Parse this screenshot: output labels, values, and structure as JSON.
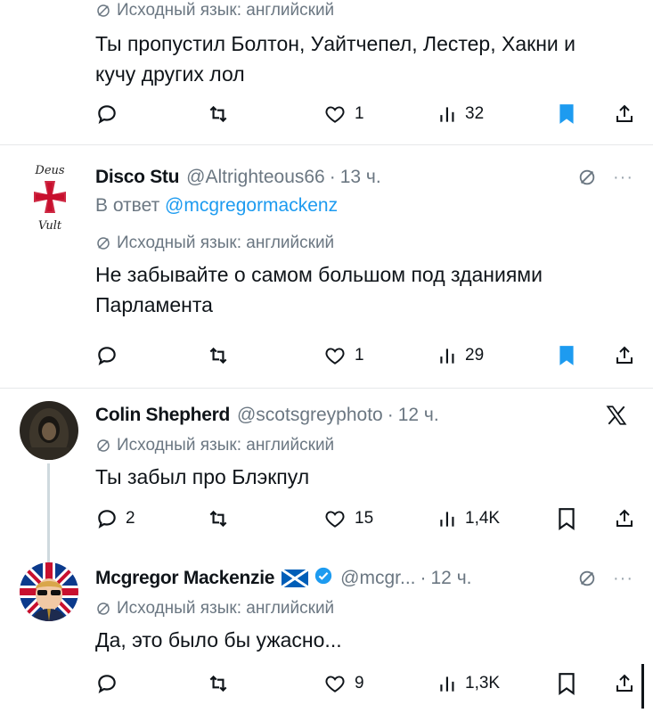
{
  "tweets": [
    {
      "translated_label": "Исходный язык: английский",
      "text": "Ты пропустил Болтон, Уайтчепел, Лестер, Хакни и кучу других лол",
      "actions": {
        "replies": "",
        "retweets": "",
        "likes": "1",
        "views": "32",
        "bookmarked": true
      }
    },
    {
      "name": "Disco Stu",
      "handle": "@Altrighteous66",
      "time": "13 ч.",
      "avatar_text_top": "Deus",
      "avatar_text_bottom": "Vult",
      "replying_prefix": "В ответ",
      "replying_to": "@mcgregormackenz",
      "translated_label": "Исходный язык: английский",
      "text": "Не забывайте о самом большом под зданиями Парламента",
      "actions": {
        "replies": "",
        "retweets": "",
        "likes": "1",
        "views": "29",
        "bookmarked": true
      }
    },
    {
      "name": "Colin Shepherd",
      "handle": "@scotsgreyphoto",
      "time": "12 ч.",
      "translated_label": "Исходный язык: английский",
      "text": "Ты забыл про Блэкпул",
      "actions": {
        "replies": "2",
        "retweets": "",
        "likes": "15",
        "views": "1,4K",
        "bookmarked": false
      }
    },
    {
      "name": "Mcgregor Mackenzie",
      "handle": "@mcgr...",
      "time": "12 ч.",
      "translated_label": "Исходный язык: английский",
      "text": "Да, это было бы ужасно...",
      "actions": {
        "replies": "",
        "retweets": "",
        "likes": "9",
        "views": "1,3K",
        "bookmarked": false
      }
    }
  ],
  "colors": {
    "text": "#0f1419",
    "muted": "#6b7782",
    "accent": "#1d9bf0",
    "bookmark_active": "#1d9bf0",
    "divider": "#e6e8ea"
  },
  "icons": [
    "reply-icon",
    "retweet-icon",
    "like-icon",
    "views-icon",
    "bookmark-icon",
    "share-icon",
    "translate-icon",
    "more-icon",
    "x-logo-icon",
    "verified-icon",
    "scotland-flag-icon"
  ]
}
